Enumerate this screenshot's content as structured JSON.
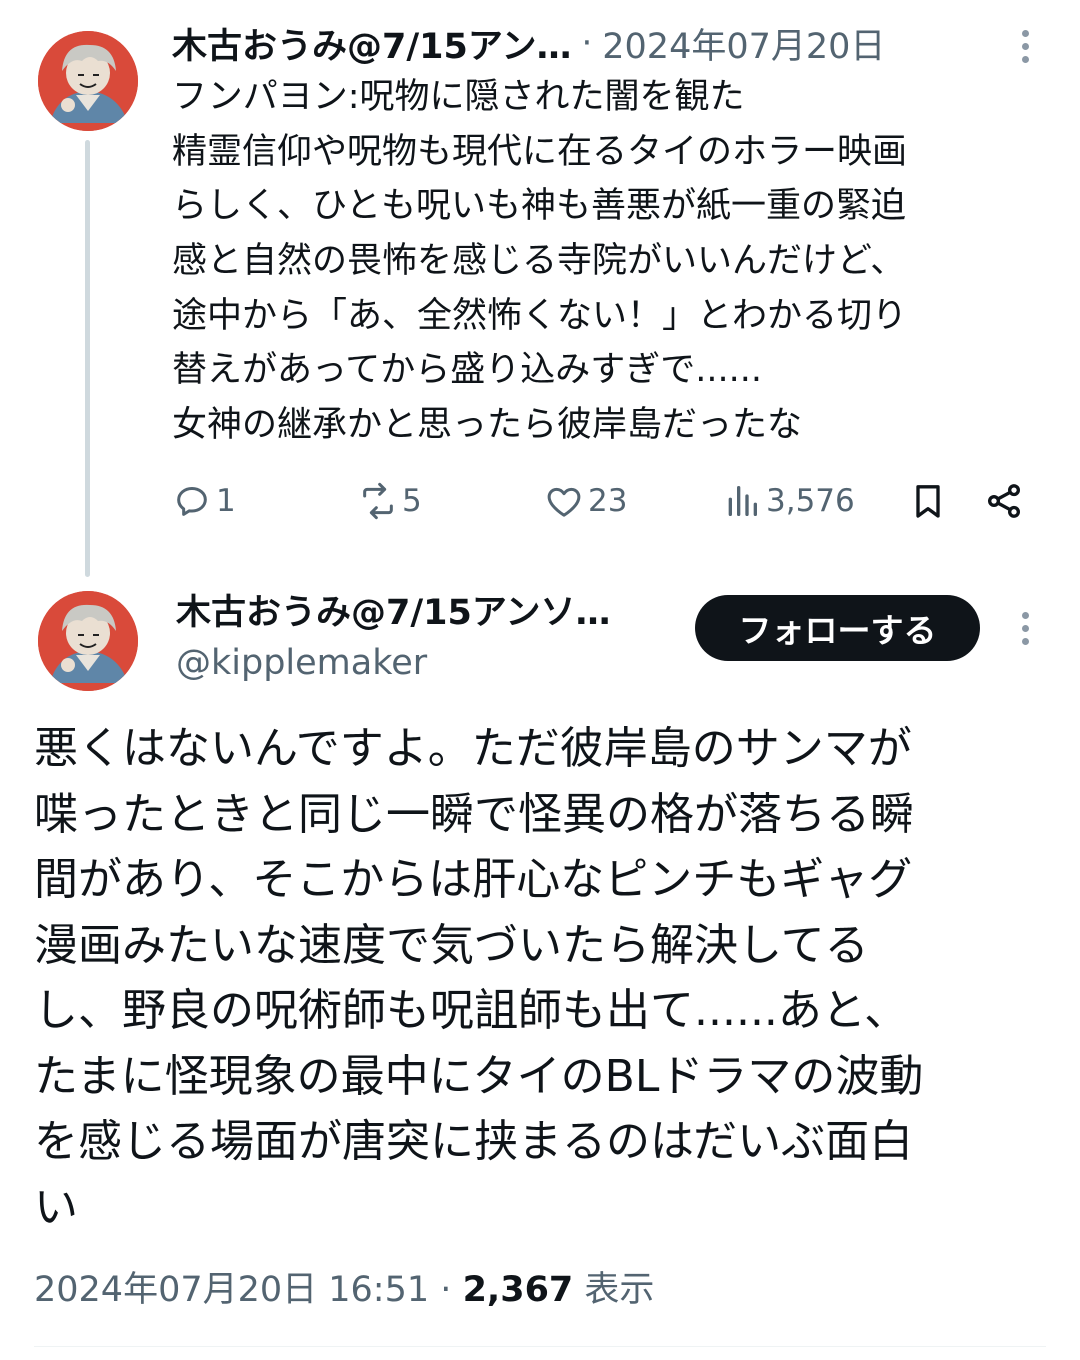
{
  "tweet1": {
    "author_name": "木古おうみ@7/15アン…",
    "separator": "·",
    "date": "2024年07月20日",
    "lines": [
      "フンパヨン:呪物に隠された闇を観た",
      "精霊信仰や呪物も現代に在るタイのホラー映画",
      "らしく、ひとも呪いも神も善悪が紙一重の緊迫",
      "感と自然の畏怖を感じる寺院がいいんだけど、",
      "途中から「あ、全然怖くない！」とわかる切り",
      "替えがあってから盛り込みすぎで......",
      "女神の継承かと思ったら彼岸島だったな"
    ],
    "actions": {
      "reply_count": "1",
      "repost_count": "5",
      "like_count": "23",
      "view_count": "3,576"
    },
    "icons": [
      "reply-icon",
      "repost-icon",
      "like-icon",
      "views-icon",
      "bookmark-icon",
      "share-icon",
      "more-icon"
    ]
  },
  "tweet2": {
    "author_name": "木古おうみ@7/15アンソ…",
    "handle": "@kipplemaker",
    "follow_label": "フォローする",
    "lines": [
      "悪くはないんですよ。ただ彼岸島のサンマが",
      "喋ったときと同じ一瞬で怪異の格が落ちる瞬",
      "間があり、そこからは肝心なピンチもギャグ",
      "漫画みたいな速度で気づいたら解決してる",
      "し、野良の呪術師も呪詛師も出て......あと、",
      "たまに怪現象の最中にタイのBLドラマの波動",
      "を感じる場面が唐突に挟まるのはだいぶ面白",
      "い"
    ],
    "timestamp": "2024年07月20日 16:51",
    "separator": "·",
    "views_count": "2,367",
    "views_label": "表示"
  },
  "colors": {
    "text": "#0f1419",
    "secondary": "#536471",
    "button_bg": "#0f1419",
    "button_text": "#ffffff",
    "thread_line": "#cfd9de",
    "avatar_bg": "#d94a3a"
  }
}
